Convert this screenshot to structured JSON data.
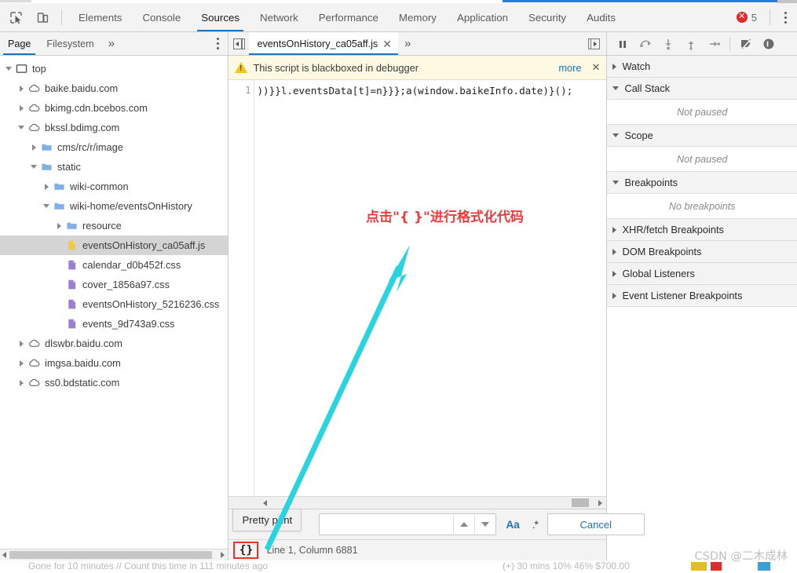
{
  "toolbar": {
    "inspect_icon": "cursor-select-icon",
    "device_icon": "device-toolbar-icon",
    "panels": [
      {
        "label": "Elements",
        "active": false
      },
      {
        "label": "Console",
        "active": false
      },
      {
        "label": "Sources",
        "active": true
      },
      {
        "label": "Network",
        "active": false
      },
      {
        "label": "Performance",
        "active": false
      },
      {
        "label": "Memory",
        "active": false
      },
      {
        "label": "Application",
        "active": false
      },
      {
        "label": "Security",
        "active": false
      },
      {
        "label": "Audits",
        "active": false
      }
    ],
    "error_count": "5",
    "error_glyph": "✕",
    "menu_icon": "kebab-menu-icon"
  },
  "navigator": {
    "tabs": [
      {
        "label": "Page",
        "active": true
      },
      {
        "label": "Filesystem",
        "active": false
      }
    ],
    "more_label": "»",
    "tree": [
      {
        "label": "top",
        "depth": 0,
        "icon": "frame",
        "arrow": "open",
        "selected": false
      },
      {
        "label": "baike.baidu.com",
        "depth": 1,
        "icon": "cloud",
        "arrow": "closed",
        "selected": false
      },
      {
        "label": "bkimg.cdn.bcebos.com",
        "depth": 1,
        "icon": "cloud",
        "arrow": "closed",
        "selected": false
      },
      {
        "label": "bkssl.bdimg.com",
        "depth": 1,
        "icon": "cloud",
        "arrow": "open",
        "selected": false
      },
      {
        "label": "cms/rc/r/image",
        "depth": 2,
        "icon": "folder",
        "arrow": "closed",
        "selected": false
      },
      {
        "label": "static",
        "depth": 2,
        "icon": "folder",
        "arrow": "open",
        "selected": false
      },
      {
        "label": "wiki-common",
        "depth": 3,
        "icon": "folder",
        "arrow": "closed",
        "selected": false
      },
      {
        "label": "wiki-home/eventsOnHistory",
        "depth": 3,
        "icon": "folder",
        "arrow": "open",
        "selected": false
      },
      {
        "label": "resource",
        "depth": 4,
        "icon": "folder",
        "arrow": "closed",
        "selected": false
      },
      {
        "label": "eventsOnHistory_ca05aff.js",
        "depth": 4,
        "icon": "js-file",
        "arrow": "none",
        "selected": true
      },
      {
        "label": "calendar_d0b452f.css",
        "depth": 4,
        "icon": "css-file",
        "arrow": "none",
        "selected": false
      },
      {
        "label": "cover_1856a97.css",
        "depth": 4,
        "icon": "css-file",
        "arrow": "none",
        "selected": false
      },
      {
        "label": "eventsOnHistory_5216236.css",
        "depth": 4,
        "icon": "css-file",
        "arrow": "none",
        "selected": false
      },
      {
        "label": "events_9d743a9.css",
        "depth": 4,
        "icon": "css-file",
        "arrow": "none",
        "selected": false
      },
      {
        "label": "dlswbr.baidu.com",
        "depth": 1,
        "icon": "cloud",
        "arrow": "closed",
        "selected": false
      },
      {
        "label": "imgsa.baidu.com",
        "depth": 1,
        "icon": "cloud",
        "arrow": "closed",
        "selected": false
      },
      {
        "label": "ss0.bdstatic.com",
        "depth": 1,
        "icon": "cloud",
        "arrow": "closed",
        "selected": false
      }
    ]
  },
  "editor": {
    "tab_prev_icon": "tab-list-left-icon",
    "tab_next_icon": "tab-list-right-icon",
    "open_tab": "eventsOnHistory_ca05aff.js",
    "close_glyph": "✕",
    "more_tabs_glyph": "»",
    "blackbox_message": "This script is blackboxed in debugger",
    "blackbox_more": "more",
    "blackbox_close": "✕",
    "line_number": "1",
    "code": "))}}l.eventsData[t]=n}}};a(window.baikeInfo.date)}();"
  },
  "search": {
    "value": "",
    "placeholder": "",
    "prev_icon": "chevron-up-icon",
    "next_icon": "chevron-down-icon",
    "match_case_label": "Aa",
    "regex_label": ".*",
    "cancel_label": "Cancel"
  },
  "pretty_print": {
    "tooltip": "Pretty print",
    "glyph": "{}",
    "highlight_color": "#e8362f"
  },
  "status": {
    "cursor": "Line 1, Column 6881"
  },
  "debugger": {
    "controls": [
      {
        "name": "pause-script-execution-icon",
        "label": "❙❙"
      },
      {
        "name": "step-over-icon",
        "label": "step-over"
      },
      {
        "name": "step-into-icon",
        "label": "step-into"
      },
      {
        "name": "step-out-icon",
        "label": "step-out"
      },
      {
        "name": "step-icon",
        "label": "step"
      },
      {
        "name": "deactivate-breakpoints-icon",
        "label": "deactivate"
      },
      {
        "name": "pause-on-exceptions-icon",
        "label": "pause-exceptions"
      }
    ],
    "sections": [
      {
        "title": "Watch",
        "expanded": false,
        "body": null
      },
      {
        "title": "Call Stack",
        "expanded": true,
        "body": "Not paused"
      },
      {
        "title": "Scope",
        "expanded": true,
        "body": "Not paused"
      },
      {
        "title": "Breakpoints",
        "expanded": true,
        "body": "No breakpoints"
      },
      {
        "title": "XHR/fetch Breakpoints",
        "expanded": false,
        "body": null
      },
      {
        "title": "DOM Breakpoints",
        "expanded": false,
        "body": null
      },
      {
        "title": "Global Listeners",
        "expanded": false,
        "body": null
      },
      {
        "title": "Event Listener Breakpoints",
        "expanded": false,
        "body": null
      }
    ]
  },
  "annotation": {
    "text": "点击\"{ }\"进行格式化代码",
    "text_color": "#ef3b3b",
    "arrow_color": "#2ad3e0"
  },
  "watermark": {
    "text": "CSDN @二木成林"
  },
  "page_behind": {
    "left_text": "Gone for 10 minutes // Count this time in 111 minutes ago",
    "right_text": "(+) 30 mins    10%   46%   $700.00"
  }
}
